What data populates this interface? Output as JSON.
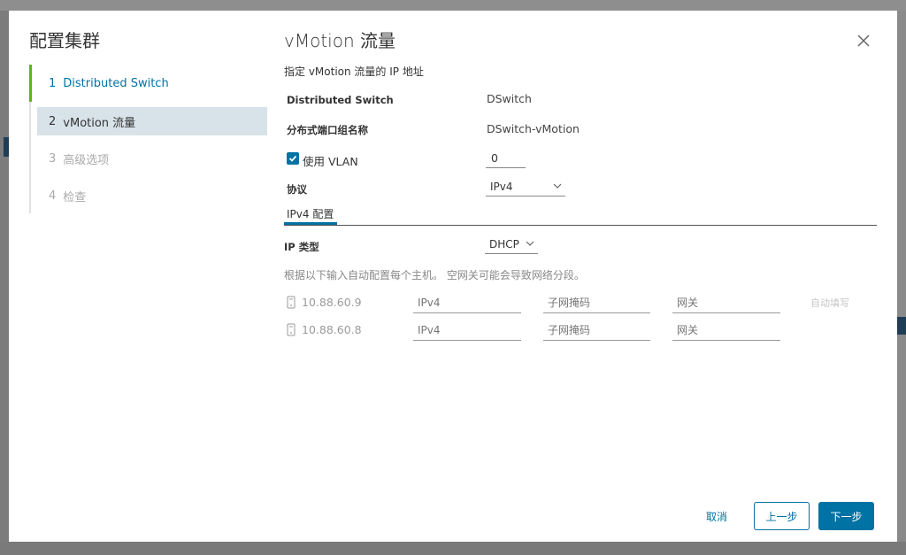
{
  "dialog": {
    "title": "配置集群",
    "content_title": "vMotion 流量",
    "subtitle": "指定 vMotion 流量的 IP 地址"
  },
  "steps": [
    {
      "num": "1",
      "label": "Distributed Switch",
      "state": "done"
    },
    {
      "num": "2",
      "label": "vMotion 流量",
      "state": "active"
    },
    {
      "num": "3",
      "label": "高级选项",
      "state": "disabled"
    },
    {
      "num": "4",
      "label": "检查",
      "state": "disabled"
    }
  ],
  "form": {
    "ds_label": "Distributed Switch",
    "ds_value": "DSwitch",
    "pg_label": "分布式端口组名称",
    "pg_value": "DSwitch-vMotion",
    "vlan_label": "使用 VLAN",
    "vlan_checked": true,
    "vlan_value": "0",
    "protocol_label": "协议",
    "protocol_value": "IPv4",
    "tab_label": "IPv4 配置",
    "iptype_label": "IP 类型",
    "iptype_value": "DHCP",
    "hint": "根据以下输入自动配置每个主机。 空网关可能会导致网络分段。",
    "autofill_label": "自动填写"
  },
  "hosts": [
    {
      "name": "10.88.60.9",
      "ip_placeholder": "IPv4",
      "mask_placeholder": "子网掩码",
      "gw_placeholder": "网关"
    },
    {
      "name": "10.88.60.8",
      "ip_placeholder": "IPv4",
      "mask_placeholder": "子网掩码",
      "gw_placeholder": "网关"
    }
  ],
  "buttons": {
    "cancel": "取消",
    "back": "上一步",
    "next": "下一步"
  },
  "colors": {
    "accent": "#0072a3",
    "done_step": "#60b515",
    "active_step_bg": "#d8e3e9"
  }
}
